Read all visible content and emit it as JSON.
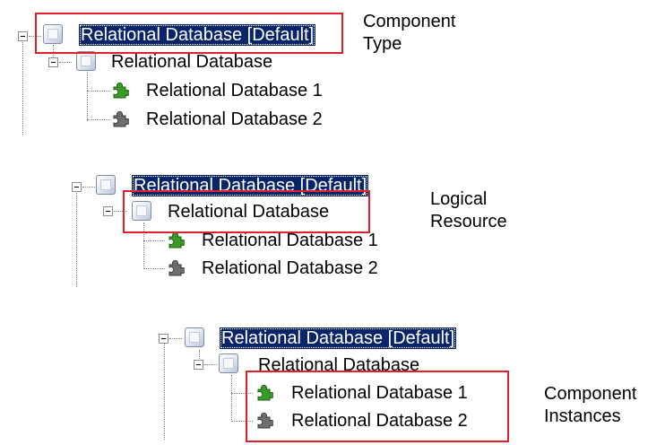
{
  "trees": [
    {
      "type_label": "Relational Database [Default]",
      "resource_label": "Relational Database",
      "instances": [
        "Relational Database 1",
        "Relational Database 2"
      ]
    },
    {
      "type_label": "Relational Database [Default]",
      "resource_label": "Relational Database",
      "instances": [
        "Relational Database 1",
        "Relational Database 2"
      ]
    },
    {
      "type_label": "Relational Database [Default]",
      "resource_label": "Relational Database",
      "instances": [
        "Relational Database 1",
        "Relational Database 2"
      ]
    }
  ],
  "callouts": {
    "component_type": [
      "Component",
      "Type"
    ],
    "logical_resource": [
      "Logical",
      "Resource"
    ],
    "component_instances": [
      "Component",
      "Instances"
    ]
  },
  "colors": {
    "highlight_box": "#e0202a",
    "selection_bg": "#0a246a",
    "instance_active": "#3a9b2a",
    "instance_inactive": "#6e6e6e"
  },
  "icons": {
    "expand": "collapse-minus-icon",
    "node": "component-cube-icon",
    "instance_1": "puzzle-green-icon",
    "instance_2": "puzzle-gray-icon"
  }
}
